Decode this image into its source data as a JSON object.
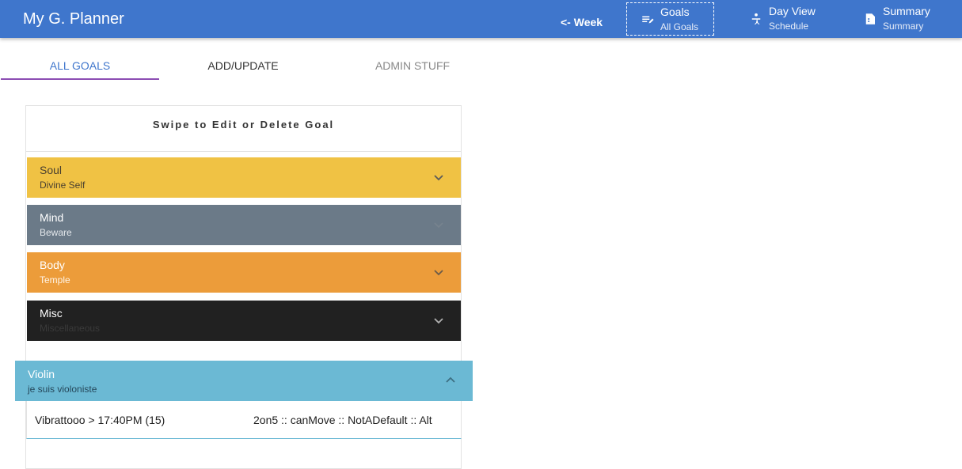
{
  "toolbar": {
    "title": "My G. Planner",
    "week_link": "<- Week",
    "nav": [
      {
        "label": "Goals",
        "sub": "All Goals",
        "icon": "edit-list-icon"
      },
      {
        "label": "Day View",
        "sub": "Schedule",
        "icon": "person-icon"
      },
      {
        "label": "Summary",
        "sub": "Summary",
        "icon": "document-icon"
      }
    ]
  },
  "tabs": [
    "ALL GOALS",
    "ADD/UPDATE",
    "ADMIN STUFF"
  ],
  "card": {
    "header": "Swipe to Edit or Delete Goal",
    "goals": [
      {
        "title": "Soul",
        "subtitle": "Divine Self",
        "color": "#f0c244"
      },
      {
        "title": "Mind",
        "subtitle": "Beware",
        "color": "#6b7a88"
      },
      {
        "title": "Body",
        "subtitle": "Temple",
        "color": "#ec9c3a"
      },
      {
        "title": "Misc",
        "subtitle": "Miscellaneous",
        "color": "#212121"
      }
    ],
    "expanded": {
      "title": "Violin",
      "subtitle": "je suis violoniste",
      "color": "#6bb9d4",
      "item_left": "Vibrattooo > 17:40PM (15)",
      "item_right": "2on5 :: canMove :: NotADefault :: Alt"
    }
  },
  "colors": {
    "toolbar": "#3f76cc",
    "tab_active": "#3f76cc",
    "tab_ink": "#8c4db3"
  }
}
